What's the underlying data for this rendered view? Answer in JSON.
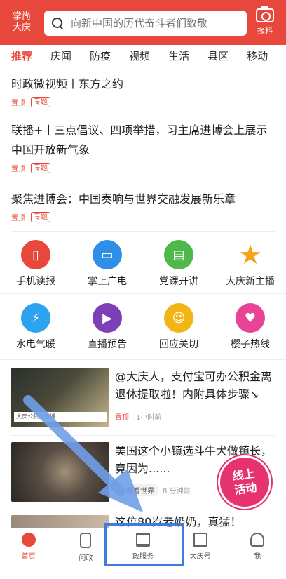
{
  "header": {
    "brand_line1": "掌尚",
    "brand_line2": "大庆",
    "search_placeholder": "向新中国的历代奋斗者们致敬",
    "report_label": "报料"
  },
  "tabs": [
    "推荐",
    "庆闻",
    "防疫",
    "视频",
    "生活",
    "县区",
    "移动"
  ],
  "articles": [
    {
      "title": "时政微视频丨东方之约",
      "pin": "置顶",
      "topic": "专题"
    },
    {
      "title": "联播+丨三点倡议、四项举措，习主席进博会上展示中国开放新气象",
      "pin": "置顶",
      "topic": "专题"
    },
    {
      "title": "聚焦进博会：中国奏响与世界交融发展新乐章",
      "pin": "置顶",
      "topic": "专题"
    }
  ],
  "services_row1": [
    {
      "label": "手机读报",
      "color": "#e8473c",
      "icon": "phone-icon"
    },
    {
      "label": "掌上广电",
      "color": "#2d8fe8",
      "icon": "tv-icon"
    },
    {
      "label": "党课开讲",
      "color": "#4fb84a",
      "icon": "book-icon"
    },
    {
      "label": "大庆新主播",
      "color": "#f2a516",
      "icon": "star-icon"
    }
  ],
  "services_row2": [
    {
      "label": "水电气暖",
      "color": "#2da2ef",
      "icon": "water-drop-icon"
    },
    {
      "label": "直播预告",
      "color": "#7c3fb5",
      "icon": "play-icon"
    },
    {
      "label": "回应关切",
      "color": "#f2b516",
      "icon": "speech-icon"
    },
    {
      "label": "樱子热线",
      "color": "#e94398",
      "icon": "heart-icon"
    }
  ],
  "news": [
    {
      "title": "@大庆人，支付宝可办公积金离退休提取啦！内附具体步骤↘",
      "pin": "置顶",
      "time": "1小时前",
      "thumb_caption": "大庆公积金微博"
    },
    {
      "title": "美国这个小镇选斗牛犬做镇长，竟因为......",
      "source": "大眼看世界",
      "time": "8 分钟前"
    },
    {
      "title": "这位80岁老奶奶，真猛！"
    }
  ],
  "live_badge": {
    "line1": "线上",
    "line2": "活动"
  },
  "bottom_nav": [
    {
      "label": "首页",
      "icon": "home-globe-icon",
      "active": true
    },
    {
      "label": "问政",
      "icon": "phone-ask-icon",
      "active": false
    },
    {
      "label": "政服务",
      "icon": "server-stack-icon",
      "active": false
    },
    {
      "label": "大庆号",
      "icon": "building-icon",
      "active": false
    },
    {
      "label": "我",
      "icon": "person-icon",
      "active": false
    }
  ],
  "colors": {
    "brand_red": "#e8473c",
    "highlight_blue": "#3f7be3"
  }
}
